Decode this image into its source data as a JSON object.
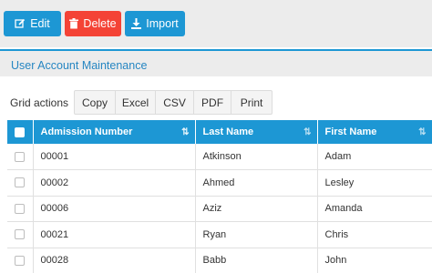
{
  "toolbar": {
    "edit_label": "Edit",
    "delete_label": "Delete",
    "import_label": "Import"
  },
  "panel": {
    "title": "User Account Maintenance"
  },
  "grid_actions": {
    "label": "Grid actions",
    "buttons": [
      "Copy",
      "Excel",
      "CSV",
      "PDF",
      "Print"
    ]
  },
  "table": {
    "columns": [
      "Admission Number",
      "Last Name",
      "First Name"
    ],
    "rows": [
      {
        "admission": "00001",
        "last": "Atkinson",
        "first": "Adam"
      },
      {
        "admission": "00002",
        "last": "Ahmed",
        "first": "Lesley"
      },
      {
        "admission": "00006",
        "last": "Aziz",
        "first": "Amanda"
      },
      {
        "admission": "00021",
        "last": "Ryan",
        "first": "Chris"
      },
      {
        "admission": "00028",
        "last": "Babb",
        "first": "John"
      }
    ]
  },
  "colors": {
    "accent": "#1d97d4",
    "danger": "#f44336"
  },
  "icons": [
    "edit-icon",
    "trash-icon",
    "download-icon",
    "sort-icon"
  ]
}
